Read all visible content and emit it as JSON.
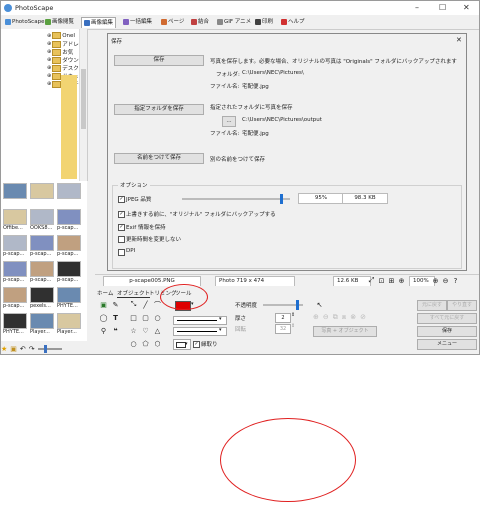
{
  "window": {
    "title": "PhotoScape",
    "controls": [
      "–",
      "☐",
      "✕"
    ]
  },
  "menu": [
    {
      "label": "PhotoScape",
      "icon": "photoscape-icon",
      "color": "#4a8fd8"
    },
    {
      "label": "画像閲覧",
      "icon": "viewer-icon",
      "color": "#5aa040"
    },
    {
      "label": "画像編集",
      "icon": "editor-icon",
      "color": "#3a70c0"
    },
    {
      "label": "一括編集",
      "icon": "batch-icon",
      "color": "#8060c0"
    },
    {
      "label": "ページ",
      "icon": "page-icon",
      "color": "#d06a30"
    },
    {
      "label": "結合",
      "icon": "combine-icon",
      "color": "#c04040"
    },
    {
      "label": "GIF アニメ",
      "icon": "gif-icon",
      "color": "#888888"
    },
    {
      "label": "印刷",
      "icon": "print-icon",
      "color": "#404040"
    },
    {
      "label": "ヘルプ",
      "icon": "help-icon",
      "color": "#d03030"
    }
  ],
  "tree": [
    "OneI",
    "アドレ",
    "お気",
    "ダウン",
    "デスク",
    "ドキュ",
    "ピクチ",
    "K",
    "C",
    "S",
    "c",
    "2",
    "タ",
    "ダ",
    "ぼ"
  ],
  "thumbs": [
    [
      "",
      "",
      ""
    ],
    [
      "Offibe...",
      "OOKS8...",
      "p-scap..."
    ],
    [
      "p-scap...",
      "p-scap...",
      "p-scap..."
    ],
    [
      "p-scap...",
      "p-scap...",
      "p-scap..."
    ],
    [
      "p-scap...",
      "pexels...",
      "PHYTE..."
    ],
    [
      "PHYTE...",
      "Player...",
      "Player..."
    ]
  ],
  "dialog": {
    "title": "保存",
    "save_button": "保存",
    "save_desc": "写真を保存します。必要な場合、オリジナルの写真は \"Originals\" フォルダにバックアップされます",
    "folder_label": "フォルダ:",
    "folder_value": "C:\\Users\\NEC\\Pictures\\",
    "file_label": "ファイル名:",
    "file_value": "宅配便.jpg",
    "save_to_folder_button": "指定フォルダを保存",
    "save_to_folder_desc": "指定されたフォルダに写真を保存",
    "browse_button": "...",
    "folder2_value": "C:\\Users\\NEC\\Pictures\\output",
    "file2_label": "ファイル名:",
    "file2_value": "宅配便.jpg",
    "save_as_button": "名前をつけて保存",
    "save_as_desc": "別の名前をつけて保存",
    "options_title": "オプション",
    "jpeg_quality_label": "JPEG 品質",
    "jpeg_quality_value": "95%",
    "jpeg_size": "98.3 KB",
    "jpeg_quality_fraction": 0.93,
    "opt_backup": "上書きする前に、\"オリジナル\" フォルダにバックアップする",
    "opt_exif": "Exif 情報を保持",
    "opt_keep_time": "更新時間を変更しない",
    "opt_dpi": "DPI",
    "close": "✕"
  },
  "status": {
    "filename": "p-scape005.PNG",
    "photo_size": "Photo 719 x 474",
    "file_size": "12.6 KB",
    "zoom": "100%"
  },
  "bottom": {
    "tabs": [
      "ホーム",
      "オブジェクト",
      "トリミング",
      "ツール"
    ],
    "opacity_label": "不透明度",
    "opacity_fraction": 0.9,
    "thickness_label": "厚さ",
    "thickness_value": "2",
    "rotate_label": "回転",
    "rotate_value": "32",
    "photo_object_button": "写真 + オブジェクト",
    "fill_label": "縁取り",
    "undo": "元に戻す",
    "redo": "やり直す",
    "undo_all": "すべて元に戻す",
    "save": "保存",
    "menu": "メニュー",
    "current_color": "#dd0000"
  },
  "annotations": {
    "color": "#e02020"
  }
}
